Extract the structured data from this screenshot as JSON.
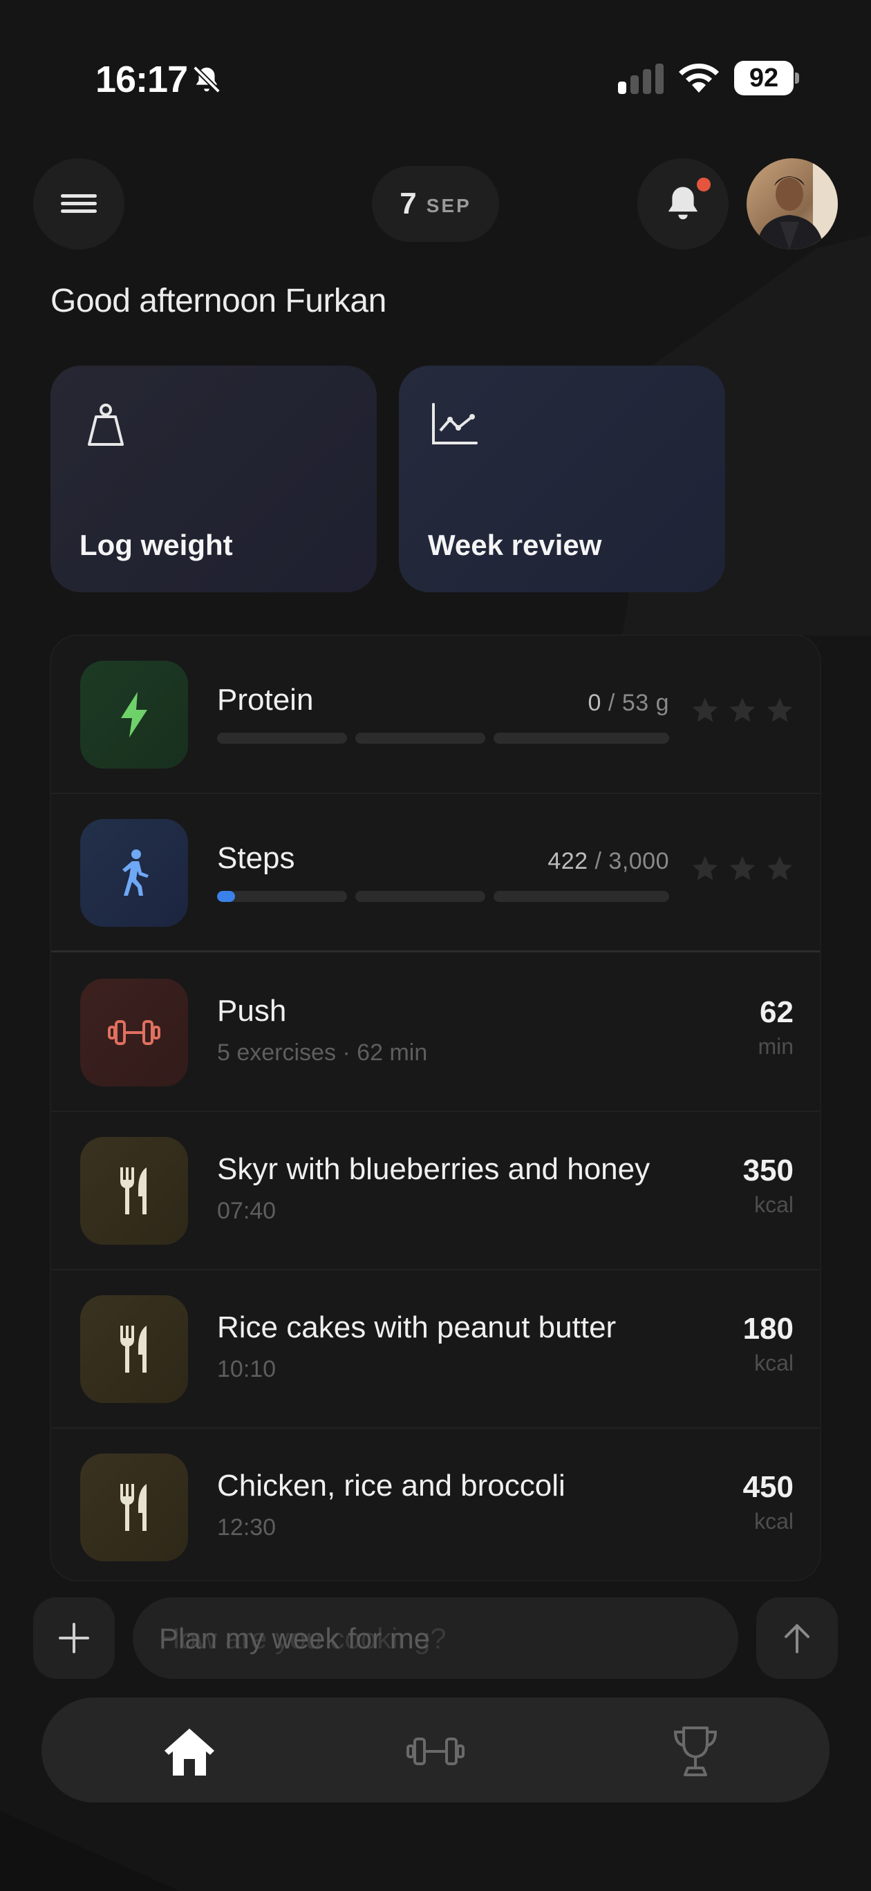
{
  "status_bar": {
    "time": "16:17",
    "battery": "92",
    "icons": [
      "bell-slash-icon",
      "cellular-signal-icon",
      "wifi-icon",
      "battery-icon"
    ]
  },
  "header": {
    "menu_icon": "hamburger-menu-icon",
    "date_day": "7",
    "date_month": "SEP",
    "notification_icon": "bell-icon",
    "notification_dot_color": "#e5553e"
  },
  "greeting": "Good afternoon Furkan",
  "quick_actions": [
    {
      "label": "Log weight",
      "icon": "scale-weight-icon"
    },
    {
      "label": "Week review",
      "icon": "line-chart-icon"
    }
  ],
  "goals": [
    {
      "title": "Protein",
      "current": "0",
      "target": "/ 53 g",
      "progress": 0,
      "icon": "lightning-bolt-icon",
      "color": "#6fd16a"
    },
    {
      "title": "Steps",
      "current": "422",
      "target": "/ 3,000",
      "progress": 0.0141,
      "icon": "walking-person-icon",
      "color": "#4a8ff0"
    }
  ],
  "entries": [
    {
      "title": "Push",
      "subtitle": "5 exercises · 62 min",
      "value": "62",
      "unit": "min",
      "icon": "dumbbell-icon",
      "color": "#e0705f"
    },
    {
      "title": "Skyr with blueberries and honey",
      "subtitle": "07:40",
      "value": "350",
      "unit": "kcal",
      "icon": "fork-knife-icon"
    },
    {
      "title": "Rice cakes with peanut butter",
      "subtitle": "10:10",
      "value": "180",
      "unit": "kcal",
      "icon": "fork-knife-icon"
    },
    {
      "title": "Chicken, rice and broccoli",
      "subtitle": "12:30",
      "value": "450",
      "unit": "kcal",
      "icon": "fork-knife-icon"
    }
  ],
  "composer": {
    "placeholder": "Plan my week for me",
    "placeholder_fading": "How are you cooking?"
  },
  "tabs": [
    {
      "name": "home",
      "icon": "home-icon",
      "active": true
    },
    {
      "name": "workouts",
      "icon": "dumbbell-icon",
      "active": false
    },
    {
      "name": "achievements",
      "icon": "trophy-icon",
      "active": false
    }
  ]
}
